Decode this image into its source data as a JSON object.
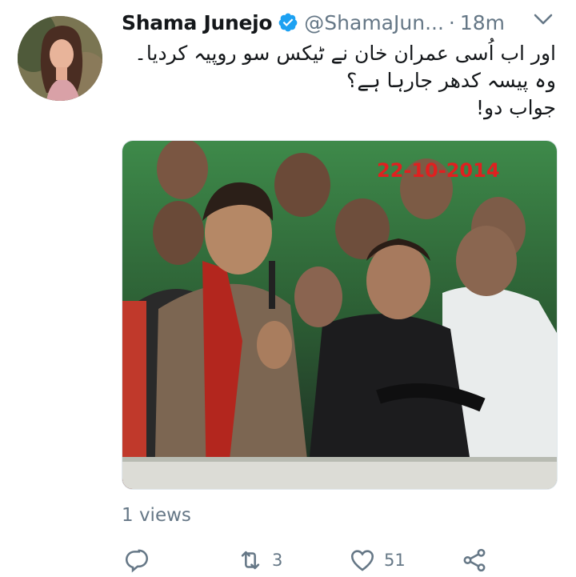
{
  "tweet": {
    "author_name": "Shama Junejo",
    "handle": "@ShamaJun...",
    "separator": "·",
    "time": "18m",
    "text_lines": [
      "اور اب اُسی عمران خان نے ٹیکس سو روپیہ کردیا۔",
      "وہ پیسہ کدھر جارہا ہے؟",
      "جواب دو!"
    ],
    "media_date_overlay": "22-10-2014",
    "views": "1 views",
    "retweet_count": "3",
    "like_count": "51"
  },
  "icons": {
    "verified": "verified-badge-icon",
    "menu": "chevron-down-icon",
    "reply": "reply-icon",
    "retweet": "retweet-icon",
    "like": "heart-icon",
    "share": "share-icon"
  },
  "colors": {
    "verified": "#1da1f2",
    "secondary_text": "#657786",
    "date_overlay": "#e02020"
  }
}
